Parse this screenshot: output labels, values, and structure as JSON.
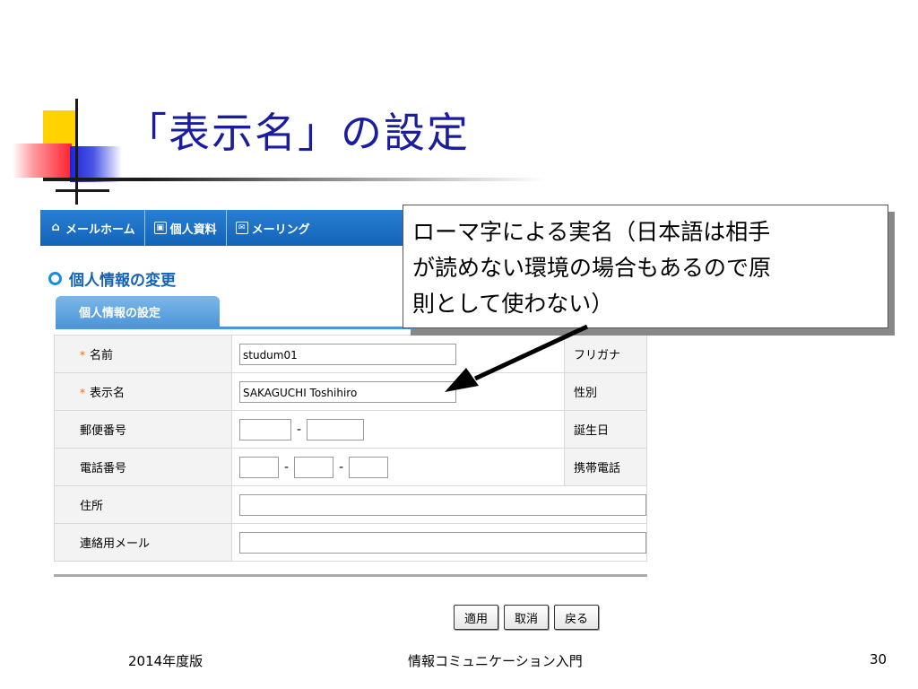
{
  "slide": {
    "title": "「表示名」の設定",
    "footer_left": "2014年度版",
    "footer_center": "情報コミュニケーション入門",
    "page_number": "30"
  },
  "nav": {
    "items": [
      {
        "label": "メールホーム",
        "icon": "home-icon"
      },
      {
        "label": "個人資料",
        "icon": "address-book-icon"
      },
      {
        "label": "メーリング",
        "icon": "mail-icon"
      }
    ]
  },
  "page": {
    "section_title": "個人情報の変更",
    "tab_label": "個人情報の設定"
  },
  "form": {
    "name_label": "名前",
    "name_value": "studum01",
    "furigana_label": "フリガナ",
    "display_name_label": "表示名",
    "display_name_value": "SAKAGUCHI Toshihiro",
    "gender_label": "性別",
    "postal_label": "郵便番号",
    "birthday_label": "誕生日",
    "phone_label": "電話番号",
    "mobile_label": "携帯電話",
    "address_label": "住所",
    "contact_mail_label": "連絡用メール",
    "dash": "-"
  },
  "buttons": {
    "apply": "適用",
    "cancel": "取消",
    "back": "戻る"
  },
  "callout": {
    "line1": "ローマ字による実名（日本語は相手",
    "line2": "が読めない環境の場合もあるので原",
    "line3": "則として使わない）"
  }
}
